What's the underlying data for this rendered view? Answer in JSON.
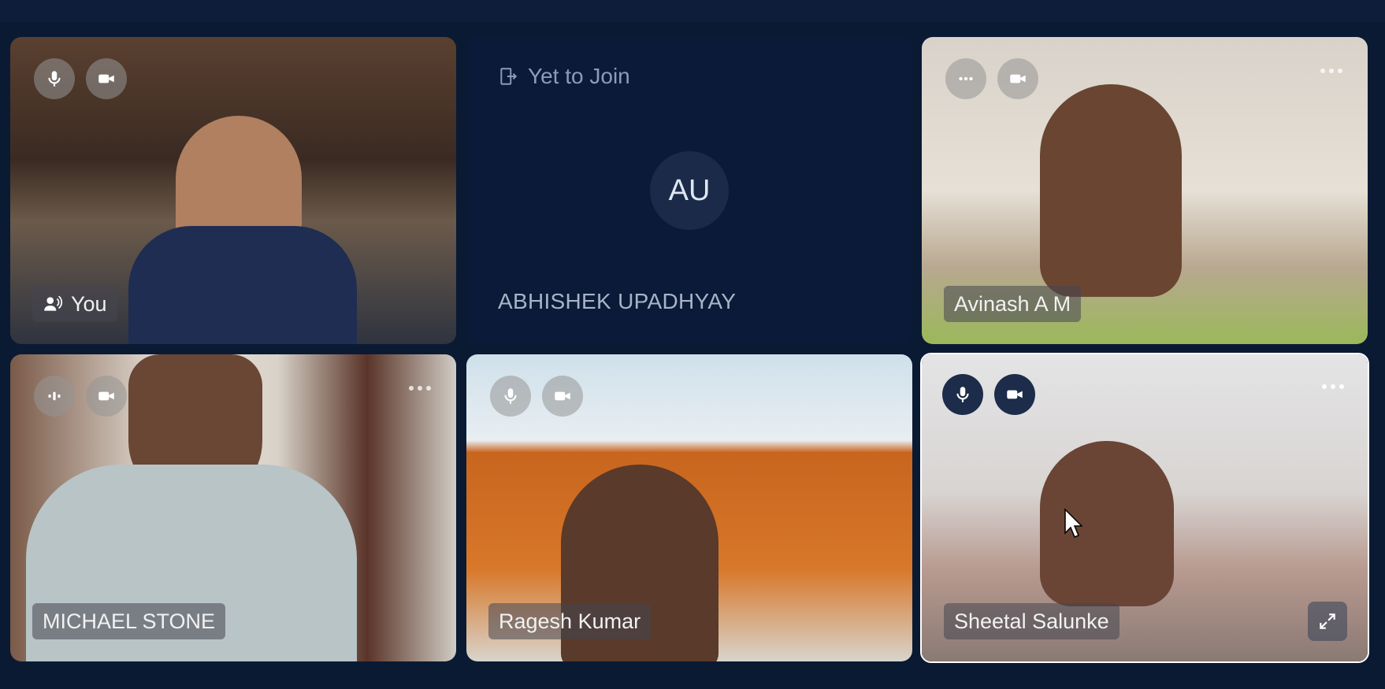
{
  "tiles": [
    {
      "id": "you",
      "name": "You",
      "mic": "mic-icon",
      "cam": "camera-icon"
    },
    {
      "id": "abhishek",
      "status": "Yet to Join",
      "initials": "AU",
      "name": "ABHISHEK UPADHYAY"
    },
    {
      "id": "avinash",
      "name": "Avinash A M",
      "cam": "camera-icon"
    },
    {
      "id": "michael",
      "name": "MICHAEL STONE",
      "cam": "camera-icon"
    },
    {
      "id": "ragesh",
      "name": "Ragesh Kumar",
      "mic": "mic-icon",
      "cam": "camera-icon"
    },
    {
      "id": "sheetal",
      "name": "Sheetal Salunke",
      "mic": "mic-icon",
      "cam": "camera-icon"
    }
  ],
  "colors": {
    "background": "#0b1a33",
    "tile_dark": "#0a1a38",
    "accent_dark_ctrl": "#1c2c4a"
  }
}
